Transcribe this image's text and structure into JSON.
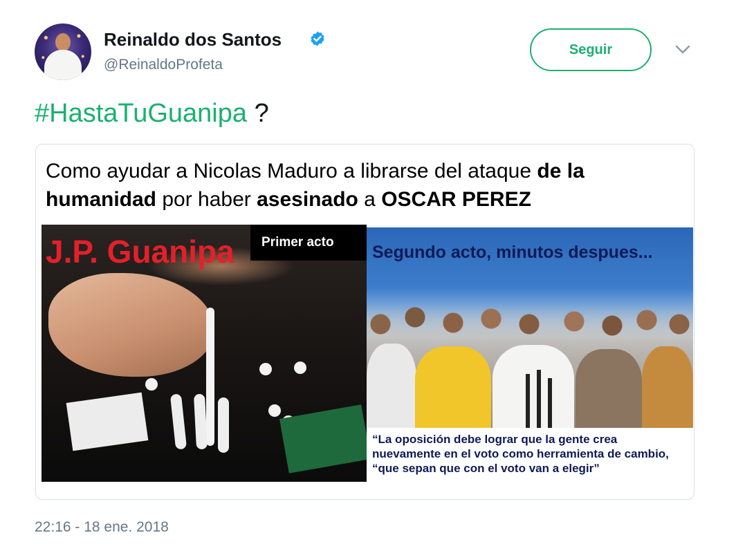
{
  "author": {
    "name": "Reinaldo dos Santos",
    "handle": "@ReinaldoProfeta",
    "verified_icon": "verified-badge-icon",
    "avatar_icon": "profile-avatar"
  },
  "actions": {
    "follow_label": "Seguir",
    "menu_icon": "chevron-down-icon"
  },
  "tweet": {
    "hashtag": "#HastaTuGuanipa",
    "rest": " ?",
    "timestamp": "22:16 - 18 ene. 2018"
  },
  "card": {
    "headline": {
      "part1": "Como ayudar a Nicolas Maduro a librarse del ataque ",
      "bold1": "de la humanidad",
      "part2": " por haber ",
      "bold2": "asesinado",
      "part3": " a ",
      "bold3": "OSCAR PEREZ"
    },
    "left_panel": {
      "title": "J.P. Guanipa",
      "label": "Primer acto"
    },
    "right_panel": {
      "title": "Segundo acto, minutos despues...",
      "quote_line1": "“La oposición debe lograr que la gente crea",
      "quote_line2": "nuevamente en el voto como herramienta de cambio,",
      "quote_line3": "“que sepan que con el voto van a elegir”"
    }
  },
  "colors": {
    "accent": "#1ab16f",
    "verified": "#1da1f2",
    "secondary_text": "#657786",
    "left_title_red": "#e3202a",
    "right_title_navy": "#0f1a55"
  }
}
